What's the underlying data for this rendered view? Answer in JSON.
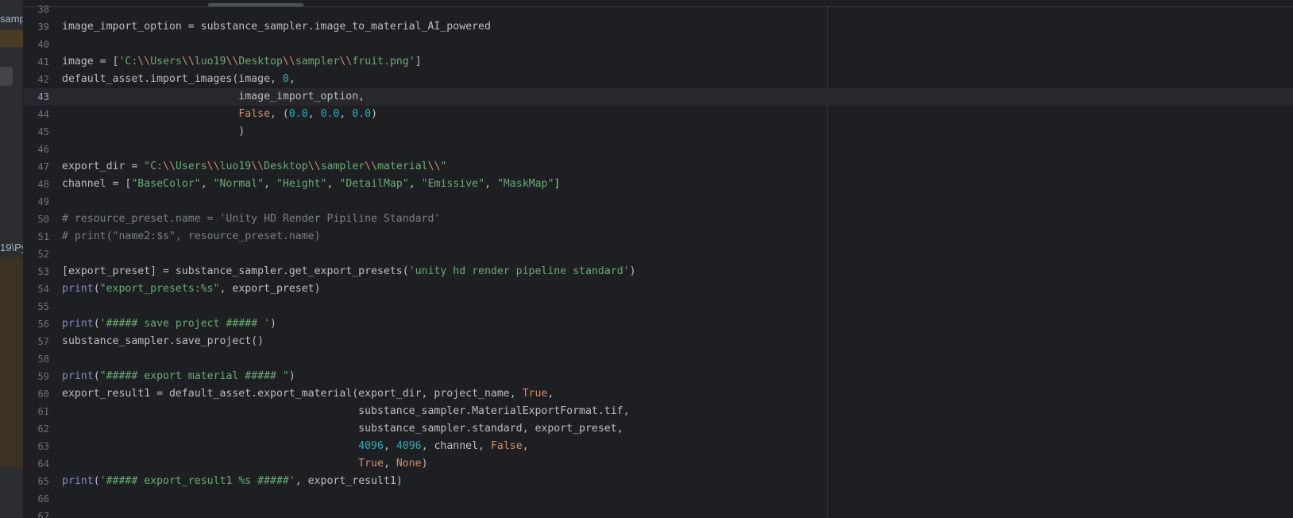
{
  "left_panel": {
    "text_top": "samp",
    "text_bottom": "19\\Py"
  },
  "editor": {
    "current_line": 43,
    "lines": [
      {
        "n": "38",
        "segments": []
      },
      {
        "n": "39",
        "segments": [
          {
            "t": "image_import_option = substance_sampler.image_to_material_AI_powered"
          }
        ]
      },
      {
        "n": "40",
        "segments": []
      },
      {
        "n": "41",
        "segments": [
          {
            "t": "image = ["
          },
          {
            "t": "'C:",
            "c": "str"
          },
          {
            "t": "\\\\",
            "c": "esc"
          },
          {
            "t": "Users",
            "c": "str"
          },
          {
            "t": "\\\\",
            "c": "esc"
          },
          {
            "t": "luo19",
            "c": "str"
          },
          {
            "t": "\\\\",
            "c": "esc"
          },
          {
            "t": "Desktop",
            "c": "str"
          },
          {
            "t": "\\\\",
            "c": "esc"
          },
          {
            "t": "sampler",
            "c": "str"
          },
          {
            "t": "\\\\",
            "c": "esc"
          },
          {
            "t": "fruit.png'",
            "c": "str"
          },
          {
            "t": "]"
          }
        ]
      },
      {
        "n": "42",
        "segments": [
          {
            "t": "default_asset.import_images(image, "
          },
          {
            "t": "0",
            "c": "num"
          },
          {
            "t": ","
          }
        ]
      },
      {
        "n": "43",
        "segments": [
          {
            "t": "                            image_import_option,"
          }
        ]
      },
      {
        "n": "44",
        "segments": [
          {
            "t": "                            "
          },
          {
            "t": "False",
            "c": "kw"
          },
          {
            "t": ", ("
          },
          {
            "t": "0.0",
            "c": "num"
          },
          {
            "t": ", "
          },
          {
            "t": "0.0",
            "c": "num"
          },
          {
            "t": ", "
          },
          {
            "t": "0.0",
            "c": "num"
          },
          {
            "t": ")"
          }
        ]
      },
      {
        "n": "45",
        "segments": [
          {
            "t": "                            )"
          }
        ]
      },
      {
        "n": "46",
        "segments": []
      },
      {
        "n": "47",
        "segments": [
          {
            "t": "export_dir = "
          },
          {
            "t": "\"C:",
            "c": "str"
          },
          {
            "t": "\\\\",
            "c": "esc"
          },
          {
            "t": "Users",
            "c": "str"
          },
          {
            "t": "\\\\",
            "c": "esc"
          },
          {
            "t": "luo19",
            "c": "str"
          },
          {
            "t": "\\\\",
            "c": "esc"
          },
          {
            "t": "Desktop",
            "c": "str"
          },
          {
            "t": "\\\\",
            "c": "esc"
          },
          {
            "t": "sampler",
            "c": "str"
          },
          {
            "t": "\\\\",
            "c": "esc"
          },
          {
            "t": "material",
            "c": "str"
          },
          {
            "t": "\\\\",
            "c": "esc"
          },
          {
            "t": "\"",
            "c": "str"
          }
        ]
      },
      {
        "n": "48",
        "segments": [
          {
            "t": "channel = ["
          },
          {
            "t": "\"BaseColor\"",
            "c": "str"
          },
          {
            "t": ", "
          },
          {
            "t": "\"Normal\"",
            "c": "str"
          },
          {
            "t": ", "
          },
          {
            "t": "\"Height\"",
            "c": "str"
          },
          {
            "t": ", "
          },
          {
            "t": "\"DetailMap\"",
            "c": "str"
          },
          {
            "t": ", "
          },
          {
            "t": "\"Emissive\"",
            "c": "str"
          },
          {
            "t": ", "
          },
          {
            "t": "\"MaskMap\"",
            "c": "str"
          },
          {
            "t": "]"
          }
        ]
      },
      {
        "n": "49",
        "segments": []
      },
      {
        "n": "50",
        "segments": [
          {
            "t": "# resource_preset.name = 'Unity HD Render Pipiline Standard'",
            "c": "cm"
          }
        ]
      },
      {
        "n": "51",
        "segments": [
          {
            "t": "# print(\"name2:$s\", resource_preset.name)",
            "c": "cm"
          }
        ]
      },
      {
        "n": "52",
        "segments": []
      },
      {
        "n": "53",
        "segments": [
          {
            "t": "[export_preset] = substance_sampler.get_export_presets("
          },
          {
            "t": "'unity hd render pipeline standard'",
            "c": "str"
          },
          {
            "t": ")"
          }
        ]
      },
      {
        "n": "54",
        "segments": [
          {
            "t": "print",
            "c": "bi"
          },
          {
            "t": "("
          },
          {
            "t": "\"export_presets:%s\"",
            "c": "str"
          },
          {
            "t": ", export_preset)"
          }
        ]
      },
      {
        "n": "55",
        "segments": []
      },
      {
        "n": "56",
        "segments": [
          {
            "t": "print",
            "c": "bi"
          },
          {
            "t": "("
          },
          {
            "t": "'##### save project ##### '",
            "c": "str"
          },
          {
            "t": ")"
          }
        ]
      },
      {
        "n": "57",
        "segments": [
          {
            "t": "substance_sampler.save_project()"
          }
        ]
      },
      {
        "n": "58",
        "segments": []
      },
      {
        "n": "59",
        "segments": [
          {
            "t": "print",
            "c": "bi"
          },
          {
            "t": "("
          },
          {
            "t": "\"##### export material ##### \"",
            "c": "str"
          },
          {
            "t": ")"
          }
        ]
      },
      {
        "n": "60",
        "segments": [
          {
            "t": "export_result1 = default_asset.export_material(export_dir, project_name, "
          },
          {
            "t": "True",
            "c": "kw"
          },
          {
            "t": ","
          }
        ]
      },
      {
        "n": "61",
        "segments": [
          {
            "t": "                                               substance_sampler.MaterialExportFormat.tif,"
          }
        ]
      },
      {
        "n": "62",
        "segments": [
          {
            "t": "                                               substance_sampler.standard, export_preset,"
          }
        ]
      },
      {
        "n": "63",
        "segments": [
          {
            "t": "                                               "
          },
          {
            "t": "4096",
            "c": "num"
          },
          {
            "t": ", "
          },
          {
            "t": "4096",
            "c": "num"
          },
          {
            "t": ", channel, "
          },
          {
            "t": "False",
            "c": "kw"
          },
          {
            "t": ","
          }
        ]
      },
      {
        "n": "64",
        "segments": [
          {
            "t": "                                               "
          },
          {
            "t": "True",
            "c": "kw"
          },
          {
            "t": ", "
          },
          {
            "t": "None",
            "c": "kw"
          },
          {
            "t": ")"
          }
        ]
      },
      {
        "n": "65",
        "segments": [
          {
            "t": "print",
            "c": "bi"
          },
          {
            "t": "("
          },
          {
            "t": "'##### export_result1 %s #####'",
            "c": "str"
          },
          {
            "t": ", export_result1)"
          }
        ]
      },
      {
        "n": "66",
        "segments": []
      },
      {
        "n": "67",
        "segments": []
      }
    ]
  }
}
